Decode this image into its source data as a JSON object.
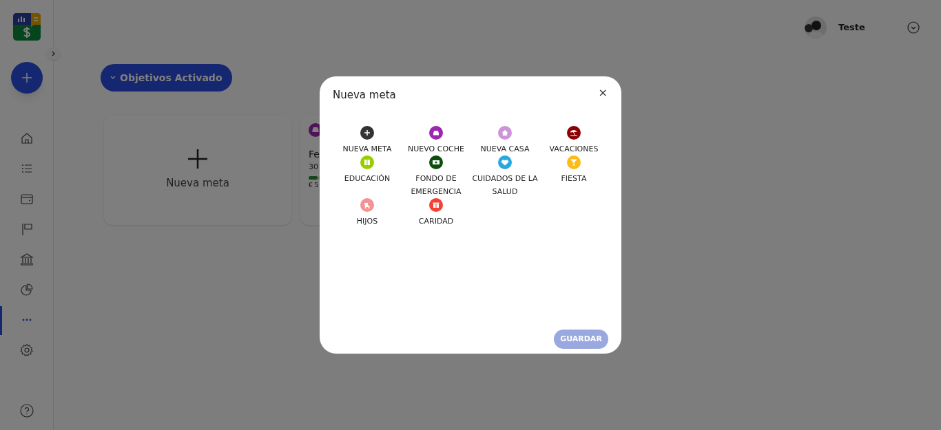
{
  "sidebar": {
    "items": [
      {
        "kind": "home",
        "selected": false
      },
      {
        "kind": "list",
        "selected": false
      },
      {
        "kind": "wallet",
        "selected": false
      },
      {
        "kind": "flag",
        "selected": false
      },
      {
        "kind": "bank",
        "selected": false
      },
      {
        "kind": "pie",
        "selected": false
      },
      {
        "kind": "more",
        "selected": true
      },
      {
        "kind": "settings",
        "selected": false
      }
    ]
  },
  "header": {
    "user_name": "Teste"
  },
  "filter_button": {
    "label": "Objetivos Activado"
  },
  "new_goal_card": {
    "label": "Nueva meta"
  },
  "goal_card": {
    "title": "Fe",
    "line": "30",
    "amount": "€ 5",
    "level": 0.1
  },
  "dialog": {
    "title": "Nueva meta",
    "close": "×",
    "options": [
      {
        "kind": "plus",
        "label": "NUEVA META",
        "color": "#333333"
      },
      {
        "kind": "car",
        "label": "NUEVO COCHE",
        "color": "#9c27b0"
      },
      {
        "kind": "house",
        "label": "NUEVA CASA",
        "color": "#ce93d8"
      },
      {
        "kind": "beach",
        "label": "VACACIONES",
        "color": "#8b0000"
      },
      {
        "kind": "book",
        "label": "EDUCACIÓN",
        "color": "#9acd00"
      },
      {
        "kind": "cash",
        "label": "FONDO DE EMERGENCIA",
        "color": "#0d4d0d"
      },
      {
        "kind": "heart",
        "label": "CUIDADOS DE LA SALUD",
        "color": "#29a8e0"
      },
      {
        "kind": "glass",
        "label": "FIESTA",
        "color": "#fbbc1a"
      },
      {
        "kind": "stroller",
        "label": "HIJOS",
        "color": "#f49393"
      },
      {
        "kind": "gift",
        "label": "CARIDAD",
        "color": "#f44336"
      }
    ],
    "save_button": {
      "label": "GUARDAR",
      "disabled": true
    }
  }
}
